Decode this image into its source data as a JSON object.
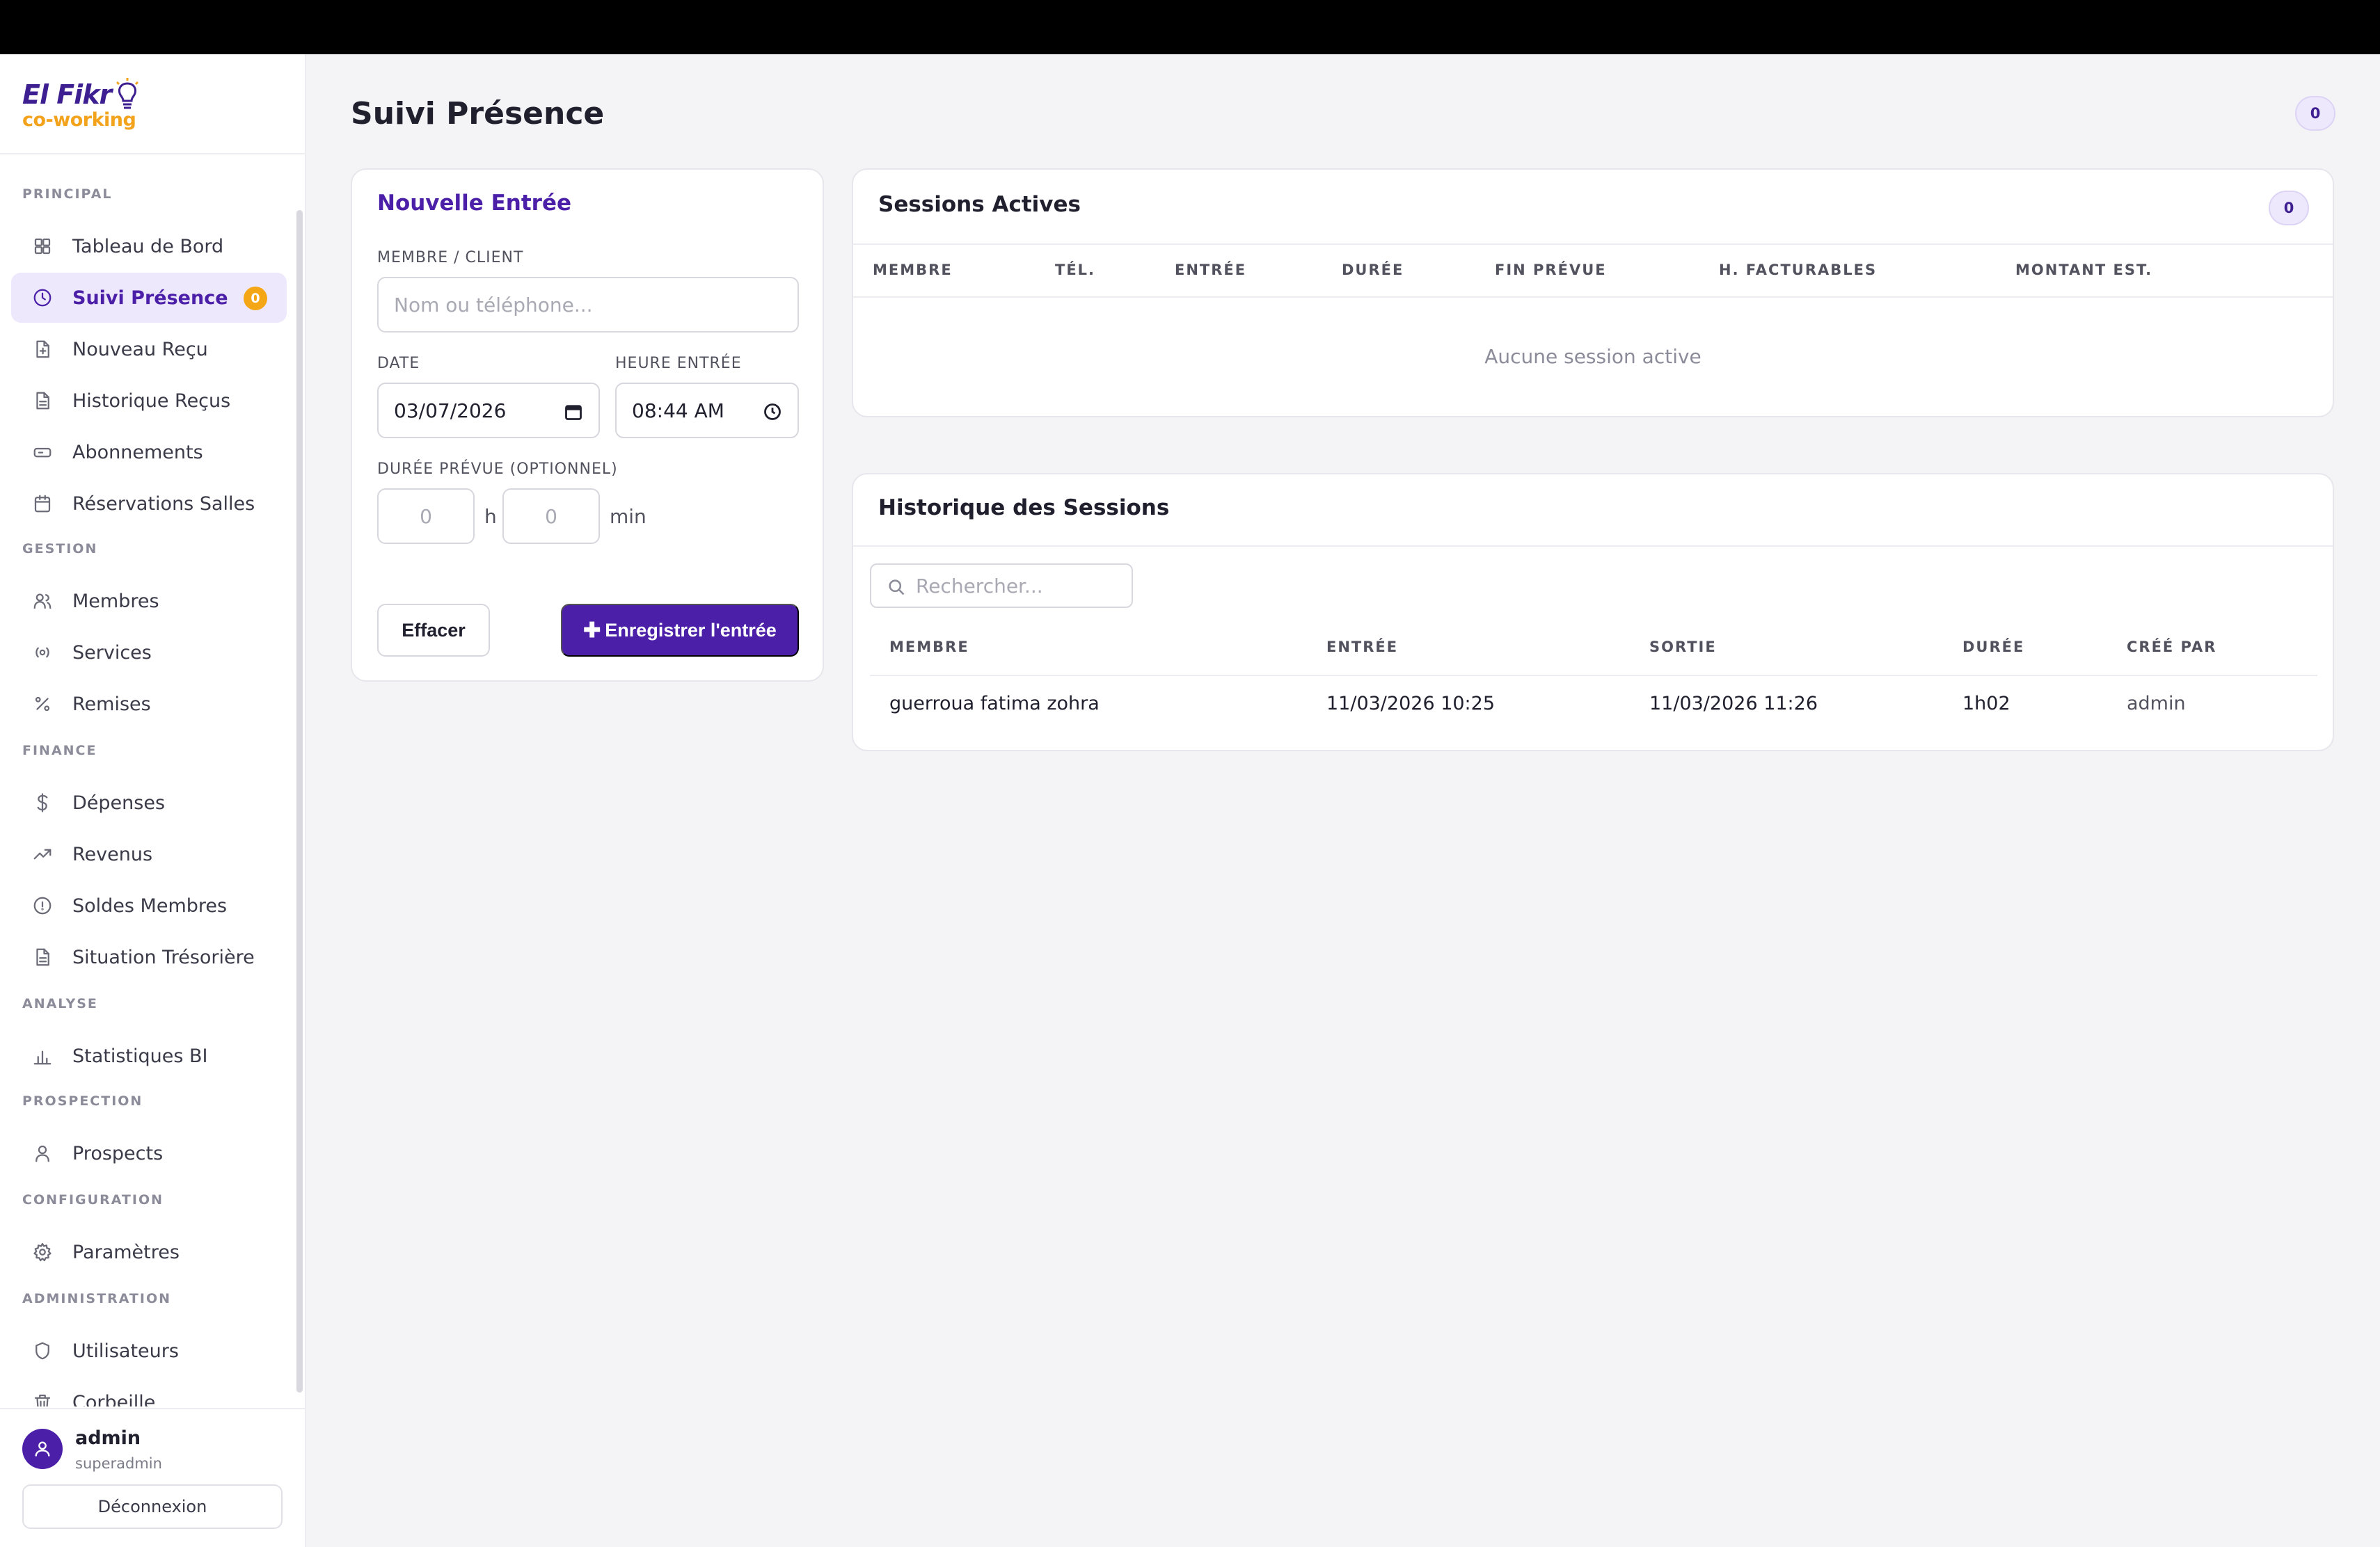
{
  "brand": {
    "name": "El Fikr",
    "sub": "co-working"
  },
  "sidebar": {
    "sections": [
      {
        "label": "PRINCIPAL",
        "items": [
          {
            "label": "Tableau de Bord",
            "icon": "grid-icon"
          },
          {
            "label": "Suivi Présence",
            "icon": "clock-icon",
            "active": true,
            "badge": "0"
          },
          {
            "label": "Nouveau Reçu",
            "icon": "file-plus-icon"
          },
          {
            "label": "Historique Reçus",
            "icon": "file-text-icon"
          },
          {
            "label": "Abonnements",
            "icon": "card-icon"
          },
          {
            "label": "Réservations Salles",
            "icon": "calendar-icon"
          }
        ]
      },
      {
        "label": "GESTION",
        "items": [
          {
            "label": "Membres",
            "icon": "users-icon"
          },
          {
            "label": "Services",
            "icon": "radio-icon"
          },
          {
            "label": "Remises",
            "icon": "percent-icon"
          }
        ]
      },
      {
        "label": "FINANCE",
        "items": [
          {
            "label": "Dépenses",
            "icon": "dollar-icon"
          },
          {
            "label": "Revenus",
            "icon": "trend-up-icon"
          },
          {
            "label": "Soldes Membres",
            "icon": "circle-icon"
          },
          {
            "label": "Situation Trésorière",
            "icon": "file-text-icon"
          }
        ]
      },
      {
        "label": "ANALYSE",
        "items": [
          {
            "label": "Statistiques BI",
            "icon": "bar-chart-icon"
          }
        ]
      },
      {
        "label": "PROSPECTION",
        "items": [
          {
            "label": "Prospects",
            "icon": "user-icon"
          }
        ]
      },
      {
        "label": "CONFIGURATION",
        "items": [
          {
            "label": "Paramètres",
            "icon": "gear-icon"
          }
        ]
      },
      {
        "label": "ADMINISTRATION",
        "items": [
          {
            "label": "Utilisateurs",
            "icon": "shield-icon"
          },
          {
            "label": "Corbeille",
            "icon": "trash-icon"
          }
        ]
      }
    ]
  },
  "user": {
    "name": "admin",
    "role": "superadmin",
    "logout": "Déconnexion"
  },
  "header": {
    "title": "Suivi Présence",
    "badge": "0"
  },
  "entry": {
    "title": "Nouvelle Entrée",
    "member_label": "MEMBRE / CLIENT",
    "member_placeholder": "Nom ou téléphone...",
    "date_label": "DATE",
    "date_value": "03/07/2026",
    "time_label": "HEURE ENTRÉE",
    "time_value": "08:44 AM",
    "duration_label": "DURÉE PRÉVUE (OPTIONNEL)",
    "hours_placeholder": "0",
    "hours_unit": "h",
    "minutes_placeholder": "0",
    "minutes_unit": "min",
    "clear_label": "Effacer",
    "save_label": "Enregistrer l'entrée"
  },
  "active_sessions": {
    "title": "Sessions Actives",
    "badge": "0",
    "columns": [
      "MEMBRE",
      "TÉL.",
      "ENTRÉE",
      "DURÉE",
      "FIN PRÉVUE",
      "H. FACTURABLES",
      "MONTANT EST."
    ],
    "empty": "Aucune session active"
  },
  "history": {
    "title": "Historique des Sessions",
    "search_placeholder": "Rechercher...",
    "columns": [
      "MEMBRE",
      "ENTRÉE",
      "SORTIE",
      "DURÉE",
      "CRÉÉ PAR"
    ],
    "rows": [
      [
        "guerroua fatima zohra",
        "11/03/2026 10:25",
        "11/03/2026 11:26",
        "1h02",
        "admin"
      ]
    ]
  },
  "colors": {
    "accent": "#4b1fa8",
    "badge": "#f5a614",
    "brand_yellow": "#f2a31b"
  }
}
